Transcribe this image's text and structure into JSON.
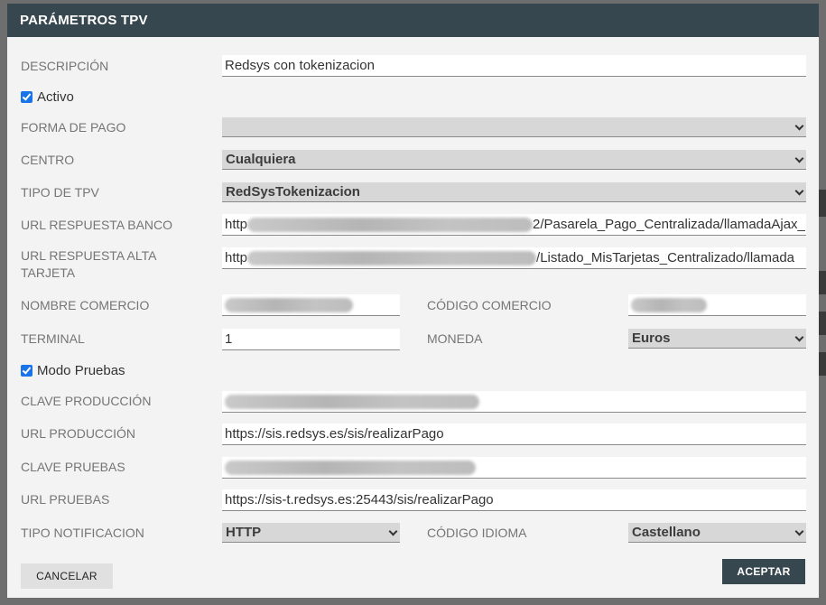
{
  "dialog": {
    "title": "PARÁMETROS TPV",
    "fields": {
      "descripcion": {
        "label": "DESCRIPCIÓN",
        "value": "Redsys con tokenizacion"
      },
      "activo": {
        "label": "Activo",
        "checked": true
      },
      "forma_pago": {
        "label": "FORMA DE PAGO",
        "value": ""
      },
      "centro": {
        "label": "CENTRO",
        "value": "Cualquiera"
      },
      "tipo_tpv": {
        "label": "TIPO DE TPV",
        "value": "RedSysTokenizacion"
      },
      "url_respuesta_banco": {
        "label": "URL RESPUESTA BANCO",
        "prefix": "http",
        "suffix": "2/Pasarela_Pago_Centralizada/llamadaAjax_"
      },
      "url_respuesta_alta": {
        "label_line1": "URL RESPUESTA ALTA",
        "label_line2": "TARJETA",
        "prefix": "http",
        "suffix": "/Listado_MisTarjetas_Centralizado/llamada"
      },
      "nombre_comercio": {
        "label": "NOMBRE COMERCIO"
      },
      "codigo_comercio": {
        "label": "CÓDIGO COMERCIO"
      },
      "terminal": {
        "label": "TERMINAL",
        "value": "1"
      },
      "moneda": {
        "label": "MONEDA",
        "value": "Euros"
      },
      "modo_pruebas": {
        "label": "Modo Pruebas",
        "checked": true
      },
      "clave_produccion": {
        "label": "CLAVE PRODUCCIÓN"
      },
      "url_produccion": {
        "label": "URL PRODUCCIÓN",
        "value": "https://sis.redsys.es/sis/realizarPago"
      },
      "clave_pruebas": {
        "label": "CLAVE PRUEBAS"
      },
      "url_pruebas": {
        "label": "URL PRUEBAS",
        "value": "https://sis-t.redsys.es:25443/sis/realizarPago"
      },
      "tipo_notificacion": {
        "label": "TIPO NOTIFICACION",
        "value": "HTTP"
      },
      "codigo_idioma": {
        "label": "CÓDIGO IDIOMA",
        "value": "Castellano"
      }
    },
    "buttons": {
      "cancel": "CANCELAR",
      "accept": "ACEPTAR"
    }
  },
  "icons": {
    "select": "chevron-down-icon",
    "checkbox": "check-icon"
  },
  "colors": {
    "header": "#37474f",
    "checkbox": "#1a73e8",
    "background": "#f3f3f3"
  }
}
